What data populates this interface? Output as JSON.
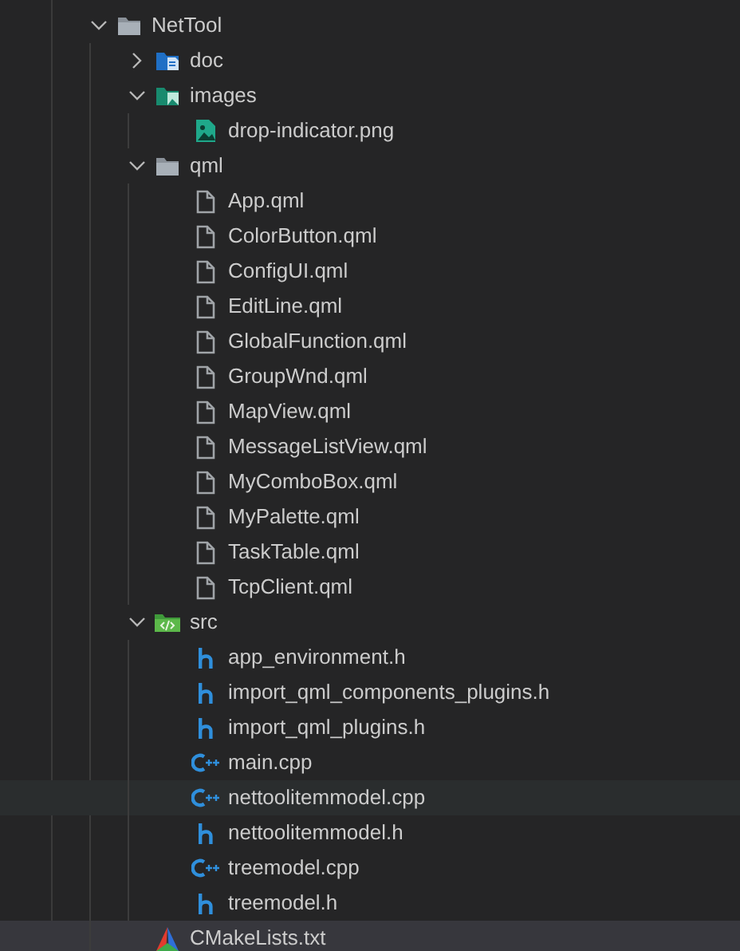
{
  "tree": [
    {
      "name": "NetTool",
      "kind": "folder",
      "expanded": true,
      "selected": false,
      "children": [
        {
          "name": "doc",
          "kind": "folder-doc",
          "expanded": false,
          "selected": false
        },
        {
          "name": "images",
          "kind": "folder-image",
          "expanded": true,
          "selected": false,
          "children": [
            {
              "name": "drop-indicator.png",
              "kind": "image",
              "selected": false
            }
          ]
        },
        {
          "name": "qml",
          "kind": "folder",
          "expanded": true,
          "selected": false,
          "children": [
            {
              "name": "App.qml",
              "kind": "file",
              "selected": false
            },
            {
              "name": "ColorButton.qml",
              "kind": "file",
              "selected": false
            },
            {
              "name": "ConfigUI.qml",
              "kind": "file",
              "selected": false
            },
            {
              "name": "EditLine.qml",
              "kind": "file",
              "selected": false
            },
            {
              "name": "GlobalFunction.qml",
              "kind": "file",
              "selected": false
            },
            {
              "name": "GroupWnd.qml",
              "kind": "file",
              "selected": false
            },
            {
              "name": "MapView.qml",
              "kind": "file",
              "selected": false
            },
            {
              "name": "MessageListView.qml",
              "kind": "file",
              "selected": false
            },
            {
              "name": "MyComboBox.qml",
              "kind": "file",
              "selected": false
            },
            {
              "name": "MyPalette.qml",
              "kind": "file",
              "selected": false
            },
            {
              "name": "TaskTable.qml",
              "kind": "file",
              "selected": false
            },
            {
              "name": "TcpClient.qml",
              "kind": "file",
              "selected": false
            }
          ]
        },
        {
          "name": "src",
          "kind": "folder-code",
          "expanded": true,
          "selected": false,
          "children": [
            {
              "name": "app_environment.h",
              "kind": "header",
              "selected": false
            },
            {
              "name": "import_qml_components_plugins.h",
              "kind": "header",
              "selected": false
            },
            {
              "name": "import_qml_plugins.h",
              "kind": "header",
              "selected": false
            },
            {
              "name": "main.cpp",
              "kind": "cpp",
              "selected": false
            },
            {
              "name": "nettoolitemmodel.cpp",
              "kind": "cpp",
              "selected": false,
              "hovered": true
            },
            {
              "name": "nettoolitemmodel.h",
              "kind": "header",
              "selected": false
            },
            {
              "name": "treemodel.cpp",
              "kind": "cpp",
              "selected": false
            },
            {
              "name": "treemodel.h",
              "kind": "header",
              "selected": false
            }
          ]
        },
        {
          "name": "CMakeLists.txt",
          "kind": "cmake",
          "selected": true
        }
      ]
    }
  ]
}
